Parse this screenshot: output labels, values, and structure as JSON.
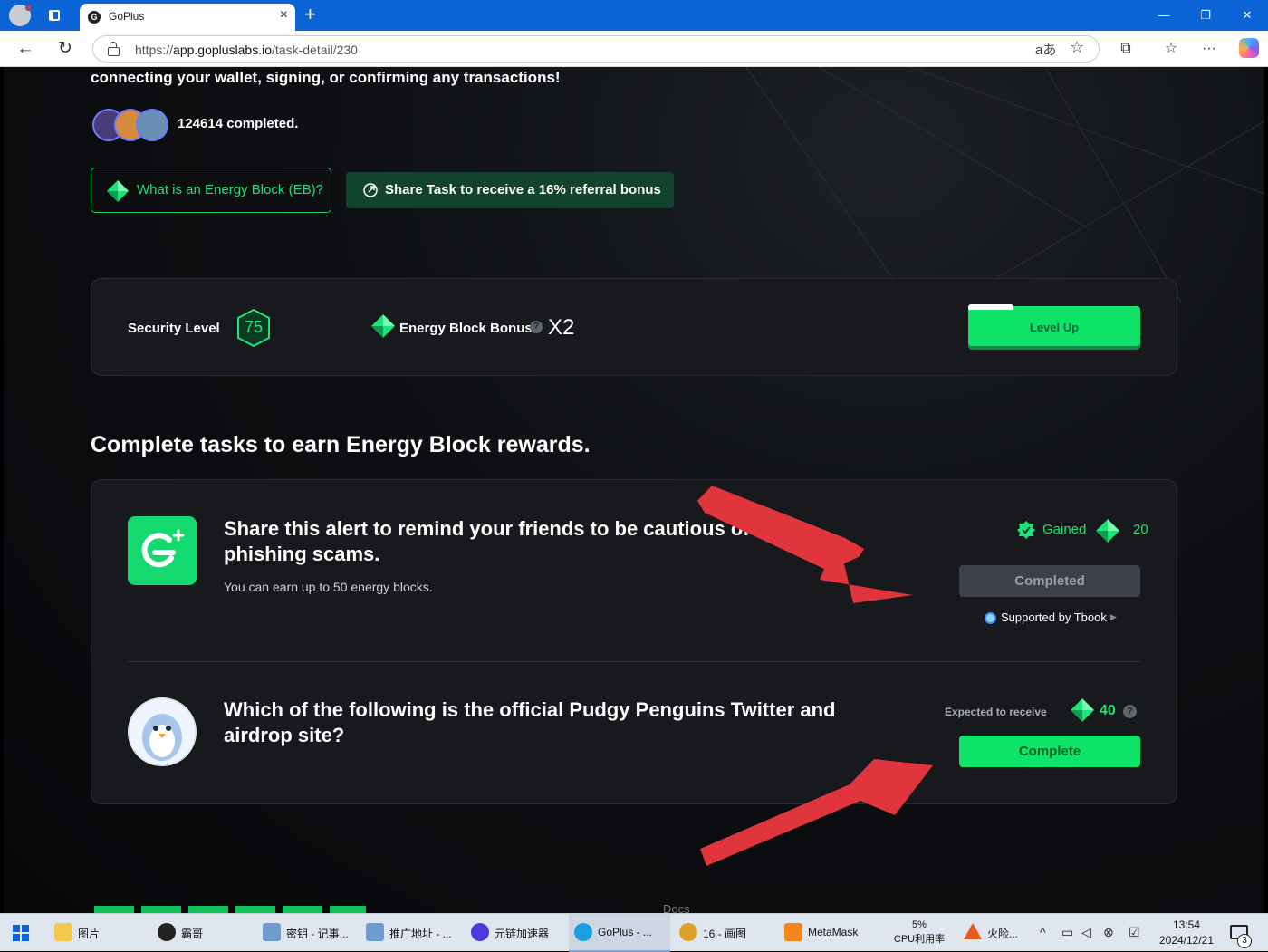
{
  "browser": {
    "tab_title": "GoPlus",
    "tab_favicon_letter": "G",
    "url_prefix": "https://",
    "url_host": "app.gopluslabs.io",
    "url_path": "/task-detail/230",
    "read_aloud_glyph": "aあ"
  },
  "page": {
    "intro_text": "connecting your wallet, signing, or confirming any transactions!",
    "completed_count": "124614 completed.",
    "eb_info_button": "What is an Energy Block (EB)?",
    "share_task_button": "Share Task to receive a 16% referral bonus",
    "security": {
      "label": "Security Level",
      "score": "75",
      "bonus_label": "Energy Block Bonus",
      "bonus_help": "?",
      "bonus_multiplier": "X2",
      "level_up_button": "Level Up"
    },
    "tasks_heading": "Complete tasks to earn Energy Block rewards.",
    "tasks": [
      {
        "title": "Share this alert to remind your friends to be cautious of phishing scams.",
        "description": "You can earn up to 50 energy blocks.",
        "status_label": "Gained",
        "amount": "20",
        "button": "Completed",
        "supported_by": "Supported by Tbook"
      },
      {
        "title": "Which of the following is the official Pudgy Penguins Twitter and airdrop site?",
        "expected_label": "Expected to receive",
        "amount": "40",
        "help": "?",
        "button": "Complete"
      }
    ],
    "footer_docs": "Docs"
  },
  "taskbar": {
    "items": [
      {
        "label": "图片",
        "color": "#f2c94c"
      },
      {
        "label": "霸哥",
        "color": "#222222"
      },
      {
        "label": "密钥 - 记事...",
        "color": "#6f9bd1"
      },
      {
        "label": "推广地址 - ...",
        "color": "#6f9bd1"
      },
      {
        "label": "元链加速器",
        "color": "#4b3bd9"
      },
      {
        "label": "GoPlus - ...",
        "color": "#1aa0e0"
      },
      {
        "label": "16 - 画图",
        "color": "#e0a12a"
      },
      {
        "label": "MetaMask",
        "color": "#f6851b"
      }
    ],
    "cpu_percent": "5%",
    "cpu_label": "CPU利用率",
    "app_label": "火险...",
    "time": "13:54",
    "date": "2024/12/21",
    "notif_count": "3"
  },
  "colors": {
    "accent_green": "#0fe46a",
    "brand_blue": "#0a64d6",
    "annotation_red": "#e0353c"
  }
}
